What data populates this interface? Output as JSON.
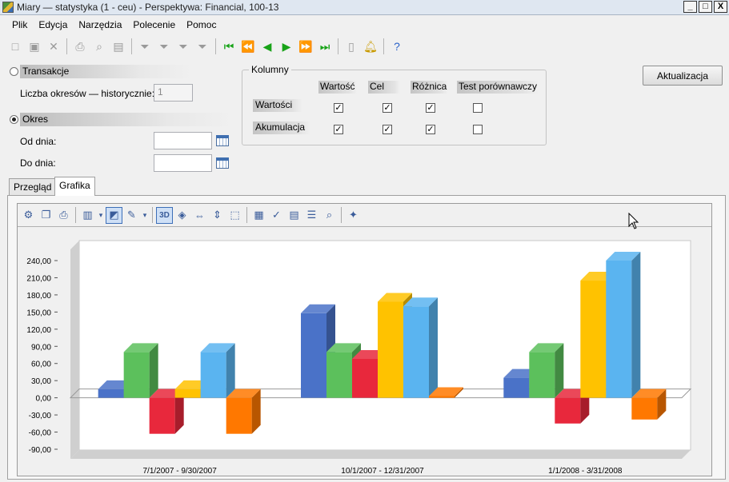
{
  "window": {
    "title": "Miary — statystyka (1 - ceu) - Perspektywa: Financial, 100-13",
    "controls": [
      "_",
      "□",
      "X"
    ]
  },
  "menu": [
    "Plik",
    "Edycja",
    "Narzędzia",
    "Polecenie",
    "Pomoc"
  ],
  "form": {
    "transakcje_label": "Transakcje",
    "periods_label": "Liczba okresów — historycznie:",
    "periods_value": "1",
    "okres_label": "Okres",
    "from_label": "Od dnia:",
    "to_label": "Do dnia:",
    "update_button": "Aktualizacja"
  },
  "kolumny": {
    "legend": "Kolumny",
    "columns": [
      "Wartość",
      "Cel",
      "Różnica",
      "Test porównawczy"
    ],
    "rows": [
      {
        "label": "Wartości",
        "checks": [
          true,
          true,
          true,
          false
        ]
      },
      {
        "label": "Akumulacja",
        "checks": [
          true,
          true,
          true,
          false
        ]
      }
    ]
  },
  "tabs": [
    "Przegląd",
    "Grafika"
  ],
  "active_tab": 1,
  "colors": {
    "blue": "#4a72c8",
    "green": "#5cc05c",
    "red": "#e8283c",
    "yellow": "#ffc200",
    "lightblue": "#5ab4f0",
    "orange": "#ff7800"
  },
  "chart_data": {
    "type": "bar",
    "categories": [
      "7/1/2007 - 9/30/2007",
      "10/1/2007 - 12/31/2007",
      "1/1/2008 - 3/31/2008"
    ],
    "series": [
      {
        "color": "#4a72c8",
        "values": [
          15,
          148,
          35
        ]
      },
      {
        "color": "#5cc05c",
        "values": [
          80,
          80,
          80
        ]
      },
      {
        "color": "#e8283c",
        "values": [
          -63,
          68,
          -45
        ]
      },
      {
        "color": "#ffc200",
        "values": [
          15,
          168,
          205
        ]
      },
      {
        "color": "#5ab4f0",
        "values": [
          80,
          160,
          240
        ]
      },
      {
        "color": "#ff7800",
        "values": [
          -63,
          3,
          -38
        ]
      }
    ],
    "ylim": [
      -90,
      240
    ],
    "yticks": [
      "240,00",
      "210,00",
      "180,00",
      "150,00",
      "120,00",
      "90,00",
      "60,00",
      "30,00",
      "0,00",
      "-30,00",
      "-60,00",
      "-90,00"
    ],
    "ytick_values": [
      240,
      210,
      180,
      150,
      120,
      90,
      60,
      30,
      0,
      -30,
      -60,
      -90
    ],
    "view": "3d",
    "grid": false,
    "legend": "none"
  }
}
